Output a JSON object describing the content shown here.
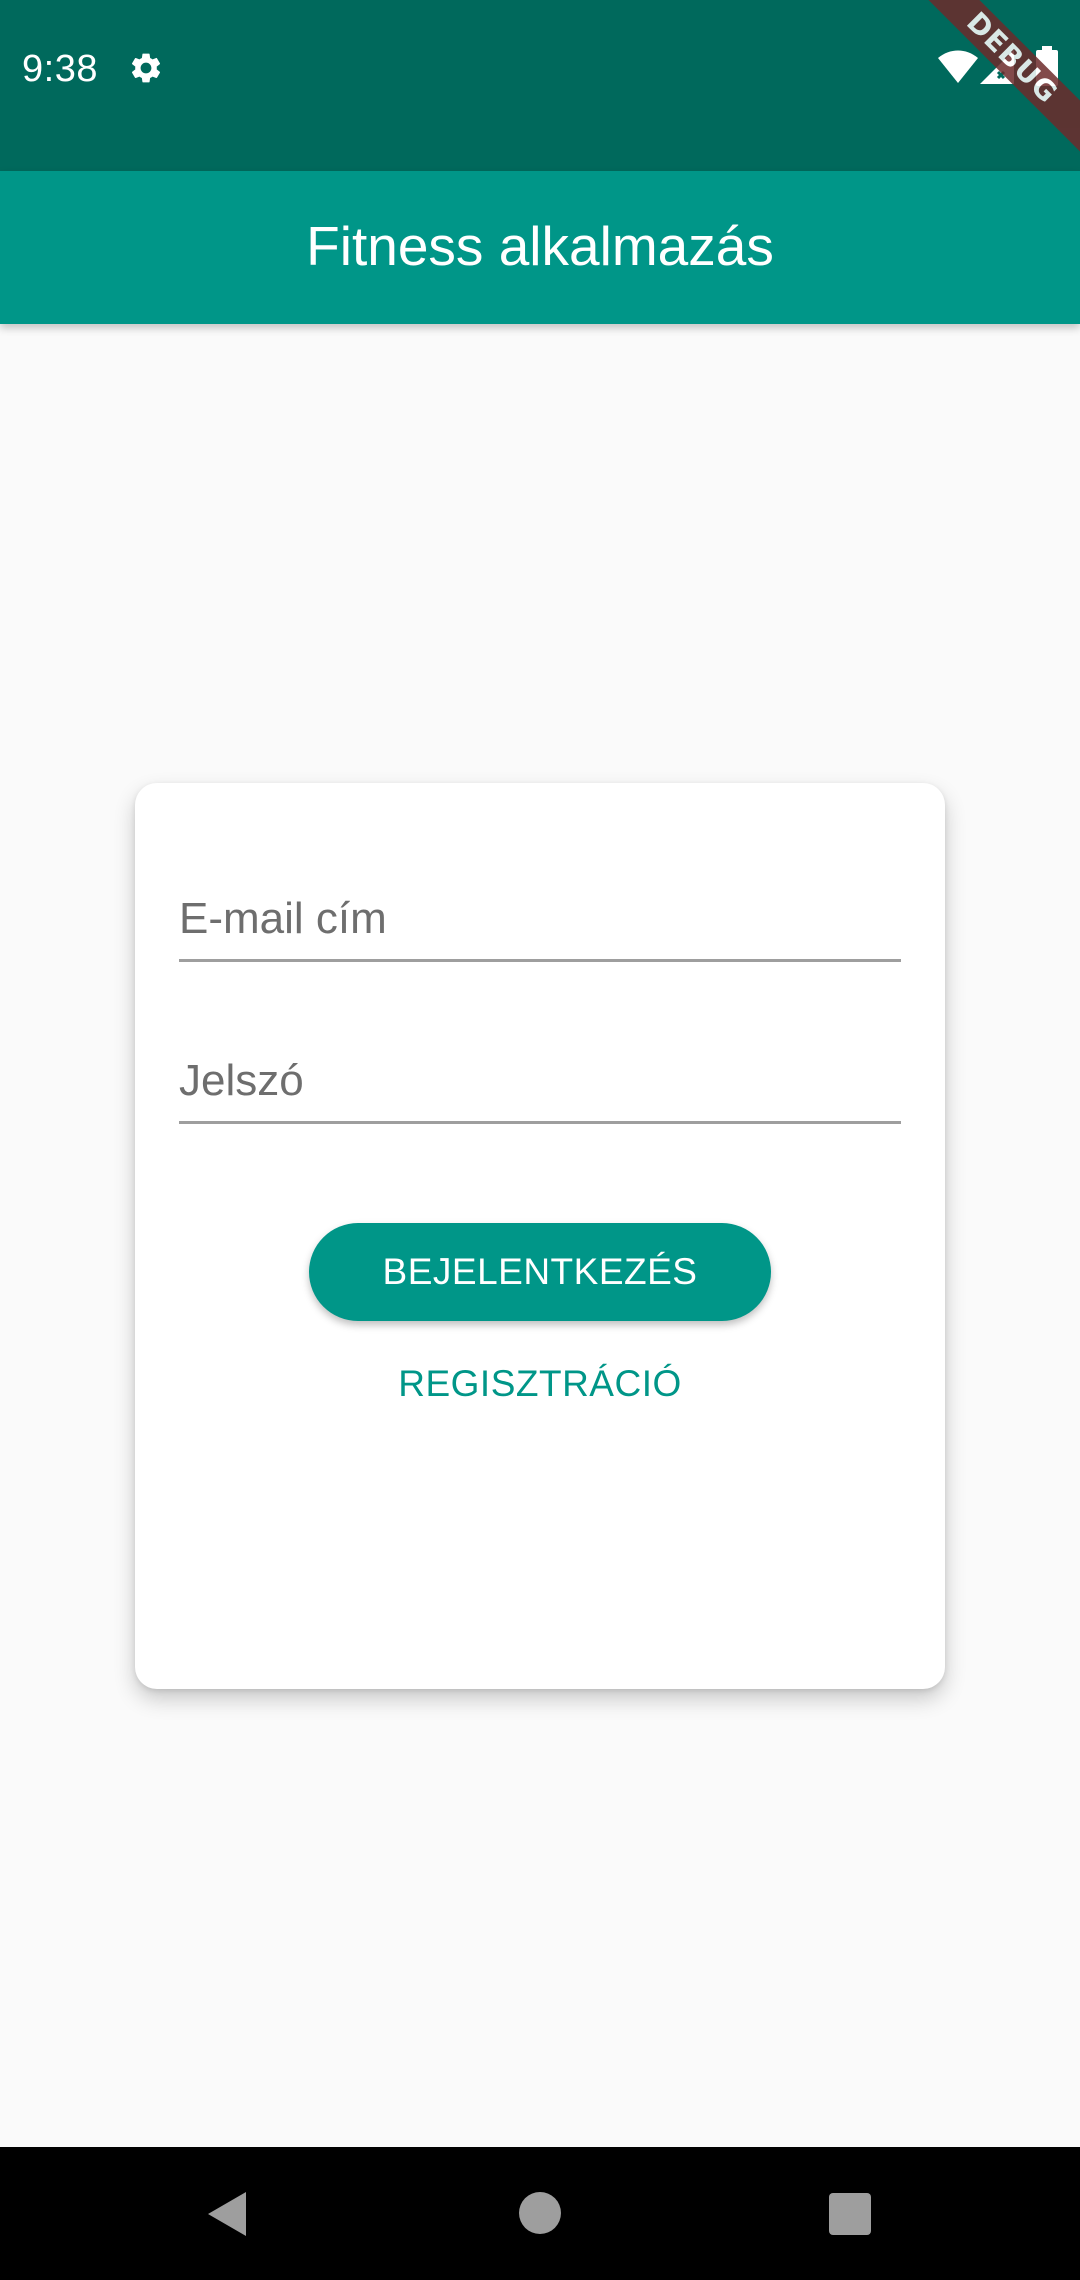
{
  "status_bar": {
    "time": "9:38",
    "icons": [
      "gear-icon",
      "wifi-icon",
      "signal-icon",
      "battery-icon"
    ],
    "background": "#00695c"
  },
  "debug_banner": {
    "label": "DEBUG",
    "color": "#6d2b2b"
  },
  "app_bar": {
    "title": "Fitness alkalmazás",
    "background": "#009688"
  },
  "login_form": {
    "email_placeholder": "E-mail cím",
    "password_placeholder": "Jelszó",
    "login_button_label": "BEJELENTKEZÉS",
    "register_link_label": "REGISZTRÁCIÓ",
    "accent_color": "#009688"
  },
  "navigation_bar": {
    "icons": [
      "back-icon",
      "home-icon",
      "recents-icon"
    ]
  }
}
